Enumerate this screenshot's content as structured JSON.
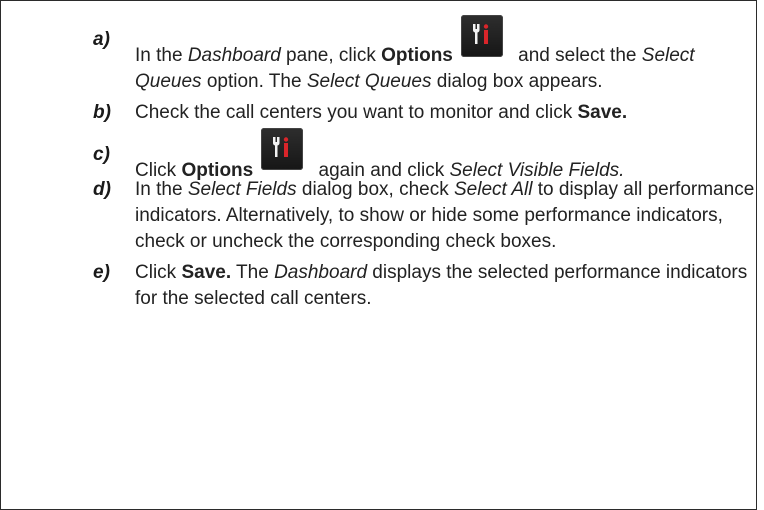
{
  "steps": [
    {
      "marker": "a)",
      "t1": "In the ",
      "dashboard": "Dashboard",
      "t2": " pane, click ",
      "options": "Options",
      "icon": "options-icon",
      "t3": " and select the ",
      "select_queues_1": "Select Queues",
      "t4": " option.  The ",
      "select_queues_2": "Select Queues",
      "t5": " dialog box appears."
    },
    {
      "marker": "b)",
      "t1": "Check the call centers you want to monitor and click ",
      "save": "Save."
    },
    {
      "marker": "c)",
      "t1": "Click ",
      "options": "Options",
      "icon": "options-icon",
      "t2": " again and click ",
      "select_visible_fields": "Select Visible Fields."
    },
    {
      "marker": "d)",
      "t1": "In the ",
      "select_fields": "Select Fields",
      "t2": " dialog box, check ",
      "select_all": "Select All",
      "t3": " to display all performance indicators.  Alternatively, to show or hide some performance indicators, check or uncheck the corresponding check boxes."
    },
    {
      "marker": "e)",
      "t1": "Click ",
      "save": "Save.",
      "t2": " The ",
      "dashboard": "Dashboard",
      "t3": " displays the selected performance indicators for the selected call centers."
    }
  ],
  "colors": {
    "text": "#222222",
    "icon_background": "#1e1e1e",
    "icon_glyph_white": "#f2f2f2",
    "icon_glyph_red": "#d9252a"
  }
}
